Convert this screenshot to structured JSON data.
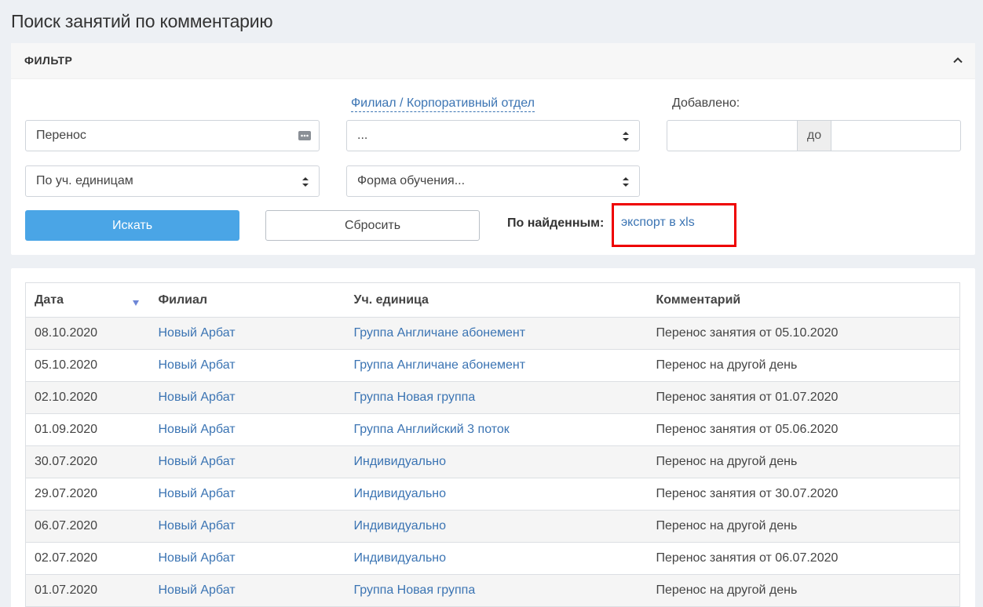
{
  "page": {
    "title": "Поиск занятий по комментарию"
  },
  "filter": {
    "header": "ФИЛЬТР",
    "comment_value": "Перенос",
    "branch_link": "Филиал / Корпоративный отдел",
    "branch_select": "...",
    "added_label": "Добавлено:",
    "date_separator": "до",
    "group_by_select": "По уч. единицам",
    "study_form_select": "Форма обучения...",
    "search_button": "Искать",
    "reset_button": "Сбросить",
    "found_label": "По найденным:",
    "export_link": "экспорт в xls",
    "highlight_color": "#ee0000"
  },
  "table": {
    "headers": {
      "date": "Дата",
      "branch": "Филиал",
      "unit": "Уч. единица",
      "comment": "Комментарий"
    },
    "rows": [
      {
        "date": "08.10.2020",
        "branch": "Новый Арбат",
        "unit": "Группа Англичане абонемент",
        "comment": "Перенос занятия от 05.10.2020"
      },
      {
        "date": "05.10.2020",
        "branch": "Новый Арбат",
        "unit": "Группа Англичане абонемент",
        "comment": "Перенос на другой день"
      },
      {
        "date": "02.10.2020",
        "branch": "Новый Арбат",
        "unit": "Группа Новая группа",
        "comment": "Перенос занятия от 01.07.2020"
      },
      {
        "date": "01.09.2020",
        "branch": "Новый Арбат",
        "unit": "Группа Английский 3 поток",
        "comment": "Перенос занятия от 05.06.2020"
      },
      {
        "date": "30.07.2020",
        "branch": "Новый Арбат",
        "unit": "Индивидуально",
        "comment": "Перенос на другой день"
      },
      {
        "date": "29.07.2020",
        "branch": "Новый Арбат",
        "unit": "Индивидуально",
        "comment": "Перенос занятия от 30.07.2020"
      },
      {
        "date": "06.07.2020",
        "branch": "Новый Арбат",
        "unit": "Индивидуально",
        "comment": "Перенос на другой день"
      },
      {
        "date": "02.07.2020",
        "branch": "Новый Арбат",
        "unit": "Индивидуально",
        "comment": "Перенос занятия от 06.07.2020"
      },
      {
        "date": "01.07.2020",
        "branch": "Новый Арбат",
        "unit": "Группа Новая группа",
        "comment": "Перенос на другой день"
      }
    ]
  },
  "colors": {
    "link": "#3b74b3",
    "primary_button": "#4aa5e6",
    "background": "#edf0f4"
  }
}
